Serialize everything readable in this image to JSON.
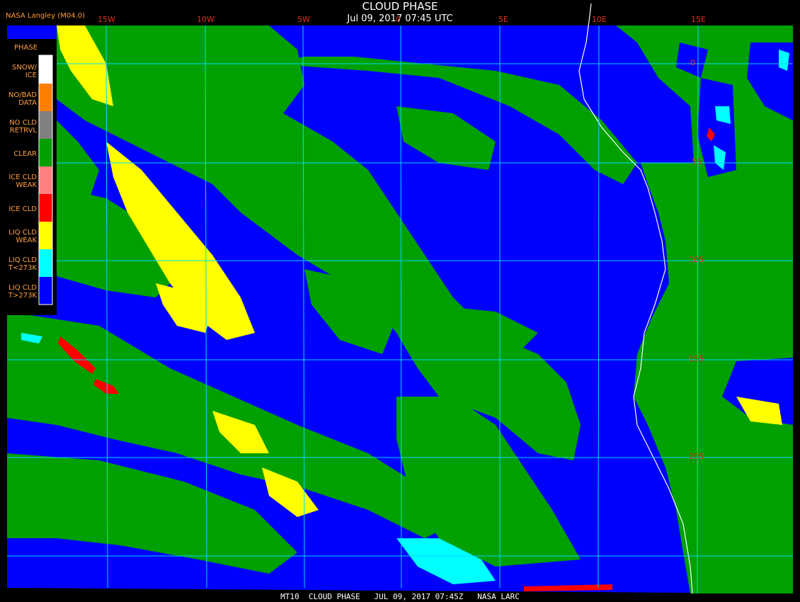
{
  "header": {
    "title": "CLOUD PHASE",
    "subtitle": "Jul 09, 2017 07:45 UTC",
    "producer": "NASA Langley (M04.0)"
  },
  "legend": {
    "title": "PHASE",
    "items": [
      {
        "label": "SNOW/\nICE",
        "color": "#ffffff"
      },
      {
        "label": "NO/BAD\nDATA",
        "color": "#ff8000"
      },
      {
        "label": "NO CLD\nRETRVL",
        "color": "#808080"
      },
      {
        "label": "CLEAR",
        "color": "#00a000"
      },
      {
        "label": "ICE CLD\nWEAK",
        "color": "#ff8080"
      },
      {
        "label": "ICE CLD",
        "color": "#ff0000"
      },
      {
        "label": "LIQ CLD\nWEAK",
        "color": "#ffff00"
      },
      {
        "label": "LIQ CLD\nT<273K",
        "color": "#00ffff"
      },
      {
        "label": "LIQ CLD\nT>273K",
        "color": "#0000ff"
      }
    ]
  },
  "longitude_labels": [
    "15W",
    "10W",
    "5W",
    "0",
    "5E",
    "10E",
    "15E"
  ],
  "latitude_labels": [
    "0",
    "5S",
    "10S",
    "15S",
    "20S"
  ],
  "footer": "MT10  CLOUD PHASE   JUL 09, 2017 07:45Z   NASA LARC",
  "colors": {
    "ocean_liquid_cloud": "#0000ff",
    "clear": "#00a000",
    "liquid_weak": "#ffff00",
    "ice": "#ff0000",
    "liquid_cold": "#00ffff",
    "grid": "#00d8ff",
    "coastline": "#ffffff",
    "label": "#e0301e"
  }
}
